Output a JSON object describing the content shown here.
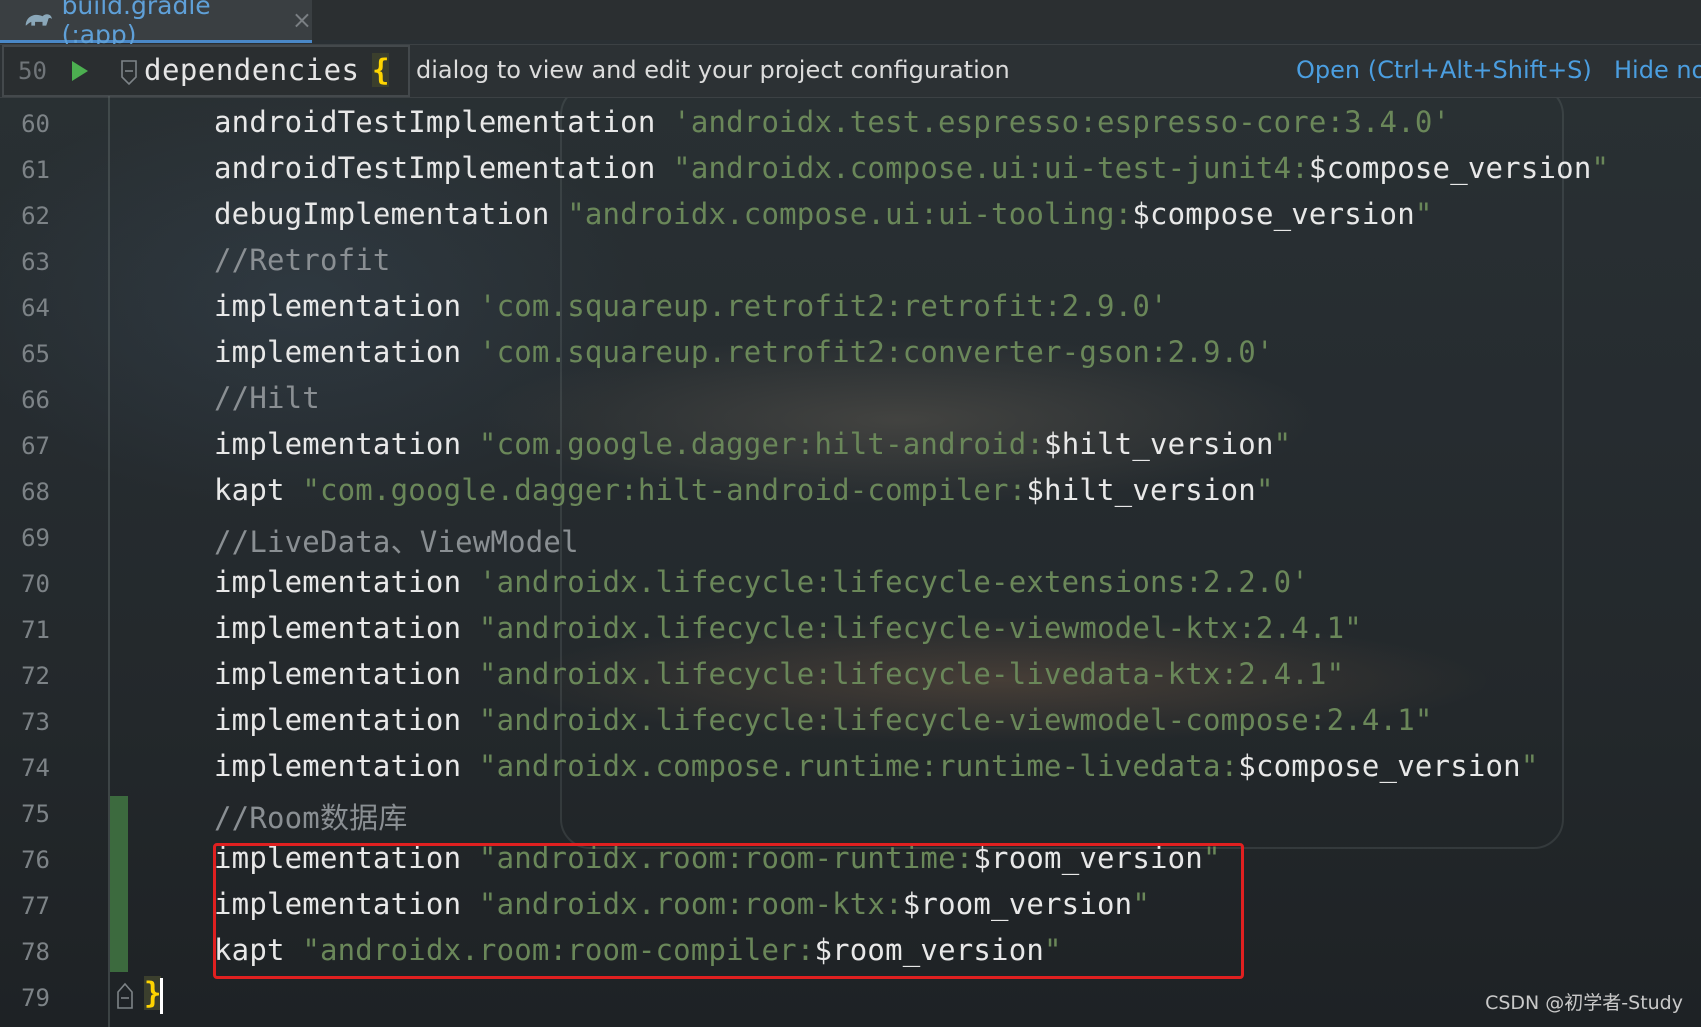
{
  "tab": {
    "label": "build.gradle (:app)",
    "close": "×",
    "icon": "gradle-icon"
  },
  "breadcrumb": {
    "line_number": "50",
    "text": "dependencies",
    "brace": "{"
  },
  "notification": {
    "message": "dialog to view and edit your project configuration",
    "open_label": "Open (Ctrl+Alt+Shift+S)",
    "hide_label": "Hide no"
  },
  "code_lines": [
    {
      "n": "60",
      "a": "androidTestImplementation ",
      "q1": "'",
      "s": "androidx.test.espresso:espresso-core:3.4.0",
      "v": "",
      "q2": "'",
      "c": ""
    },
    {
      "n": "61",
      "a": "androidTestImplementation ",
      "q1": "\"",
      "s": "androidx.compose.ui:ui-test-junit4:",
      "v": "$compose_version",
      "q2": "\"",
      "c": ""
    },
    {
      "n": "62",
      "a": "debugImplementation ",
      "q1": "\"",
      "s": "androidx.compose.ui:ui-tooling:",
      "v": "$compose_version",
      "q2": "\"",
      "c": ""
    },
    {
      "n": "63",
      "a": "",
      "q1": "",
      "s": "",
      "v": "",
      "q2": "",
      "c": "//Retrofit"
    },
    {
      "n": "64",
      "a": "implementation ",
      "q1": "'",
      "s": "com.squareup.retrofit2:retrofit:2.9.0",
      "v": "",
      "q2": "'",
      "c": ""
    },
    {
      "n": "65",
      "a": "implementation ",
      "q1": "'",
      "s": "com.squareup.retrofit2:converter-gson:2.9.0",
      "v": "",
      "q2": "'",
      "c": ""
    },
    {
      "n": "66",
      "a": "",
      "q1": "",
      "s": "",
      "v": "",
      "q2": "",
      "c": "//Hilt"
    },
    {
      "n": "67",
      "a": "implementation ",
      "q1": "\"",
      "s": "com.google.dagger:hilt-android:",
      "v": "$hilt_version",
      "q2": "\"",
      "c": ""
    },
    {
      "n": "68",
      "a": "kapt ",
      "q1": "\"",
      "s": "com.google.dagger:hilt-android-compiler:",
      "v": "$hilt_version",
      "q2": "\"",
      "c": ""
    },
    {
      "n": "69",
      "a": "",
      "q1": "",
      "s": "",
      "v": "",
      "q2": "",
      "c": "//LiveData、ViewModel"
    },
    {
      "n": "70",
      "a": "implementation ",
      "q1": "'",
      "s": "androidx.lifecycle:lifecycle-extensions:2.2.0",
      "v": "",
      "q2": "'",
      "c": ""
    },
    {
      "n": "71",
      "a": "implementation ",
      "q1": "\"",
      "s": "androidx.lifecycle:lifecycle-viewmodel-ktx:2.4.1",
      "v": "",
      "q2": "\"",
      "c": ""
    },
    {
      "n": "72",
      "a": "implementation ",
      "q1": "\"",
      "s": "androidx.lifecycle:lifecycle-livedata-ktx:2.4.1",
      "v": "",
      "q2": "\"",
      "c": ""
    },
    {
      "n": "73",
      "a": "implementation ",
      "q1": "\"",
      "s": "androidx.lifecycle:lifecycle-viewmodel-compose:2.4.1",
      "v": "",
      "q2": "\"",
      "c": ""
    },
    {
      "n": "74",
      "a": "implementation ",
      "q1": "\"",
      "s": "androidx.compose.runtime:runtime-livedata:",
      "v": "$compose_version",
      "q2": "\"",
      "c": ""
    },
    {
      "n": "75",
      "a": "",
      "q1": "",
      "s": "",
      "v": "",
      "q2": "",
      "c": "//Room数据库"
    },
    {
      "n": "76",
      "a": "implementation ",
      "q1": "\"",
      "s": "androidx.room:room-runtime:",
      "v": "$room_version",
      "q2": "\"",
      "c": ""
    },
    {
      "n": "77",
      "a": "implementation ",
      "q1": "\"",
      "s": "androidx.room:room-ktx:",
      "v": "$room_version",
      "q2": "\"",
      "c": ""
    },
    {
      "n": "78",
      "a": "kapt ",
      "q1": "\"",
      "s": "androidx.room:room-compiler:",
      "v": "$room_version",
      "q2": "\"",
      "c": ""
    },
    {
      "n": "79",
      "a": "",
      "q1": "",
      "s": "",
      "v": "",
      "q2": "",
      "c": "",
      "brace": "}"
    }
  ],
  "watermark": "CSDN @初学者-Study",
  "colors": {
    "string": "#6a8759",
    "keyword": "#e8e8e8",
    "comment": "#8a8f93",
    "brace_highlight": "#ffd500",
    "link": "#4b9ee0",
    "annotation_box": "#e02020"
  }
}
